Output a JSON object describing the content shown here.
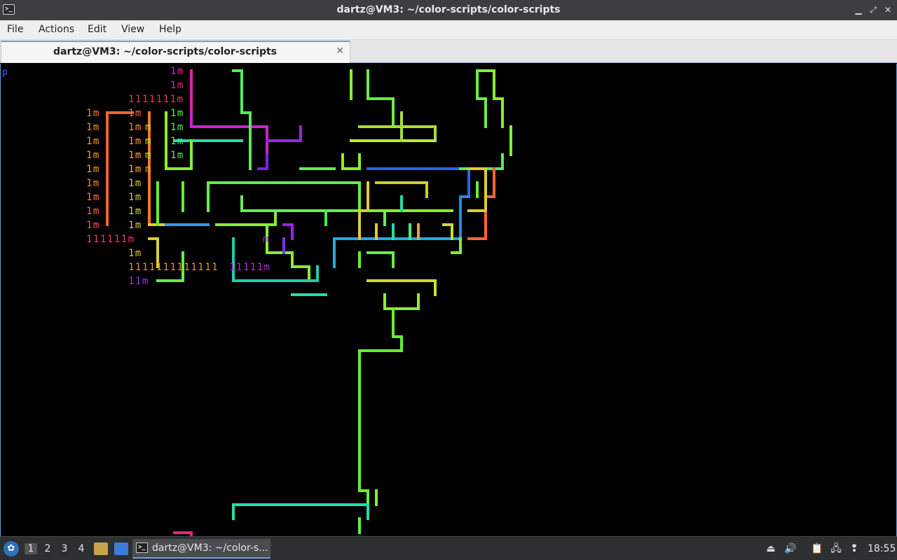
{
  "window": {
    "title": "dartz@VM3: ~/color-scripts/color-scripts",
    "app_icon": "terminal-icon",
    "controls": {
      "minimize": "▁",
      "maximize": "⤢",
      "close": "✕"
    }
  },
  "menubar": {
    "items": [
      {
        "label": "File"
      },
      {
        "label": "Actions"
      },
      {
        "label": "Edit"
      },
      {
        "label": "View"
      },
      {
        "label": "Help"
      }
    ]
  },
  "tabs": [
    {
      "label": "dartz@VM3: ~/color-scripts/color-scripts",
      "active": true
    }
  ],
  "terminal": {
    "prompt_fragment": "p",
    "text_rows": [
      {
        "text": "1m",
        "color": "#ee22aa",
        "row": 0,
        "col": 20
      },
      {
        "text": "1m",
        "color": "#ee2288",
        "row": 1,
        "col": 20
      },
      {
        "text": "1111111m",
        "color": "#ee3355",
        "row": 2,
        "col": 15
      },
      {
        "text": "1m",
        "color": "#ff7733",
        "row": 3,
        "col": 10
      },
      {
        "text": "1m",
        "color": "#ff6644",
        "row": 3,
        "col": 15
      },
      {
        "text": "1m",
        "color": "#66ee44",
        "row": 3,
        "col": 20
      },
      {
        "text": "1m",
        "color": "#ff8833",
        "row": 4,
        "col": 10
      },
      {
        "text": "1m",
        "color": "#ff8833",
        "row": 4,
        "col": 15
      },
      {
        "text": "m",
        "color": "#ddcc33",
        "row": 4,
        "col": 17
      },
      {
        "text": "1m",
        "color": "#55ee55",
        "row": 4,
        "col": 20
      },
      {
        "text": "1m",
        "color": "#ff9933",
        "row": 5,
        "col": 10
      },
      {
        "text": "1m",
        "color": "#ff9933",
        "row": 5,
        "col": 15
      },
      {
        "text": "m",
        "color": "#ccdd33",
        "row": 5,
        "col": 17
      },
      {
        "text": "1m",
        "color": "#44ee88",
        "row": 5,
        "col": 20
      },
      {
        "text": "1m",
        "color": "#ff9933",
        "row": 6,
        "col": 10
      },
      {
        "text": "1m",
        "color": "#ffaa33",
        "row": 6,
        "col": 15
      },
      {
        "text": "m",
        "color": "#bbee33",
        "row": 6,
        "col": 17
      },
      {
        "text": "1m",
        "color": "#55ee66",
        "row": 6,
        "col": 20
      },
      {
        "text": "1m",
        "color": "#ff9933",
        "row": 7,
        "col": 10
      },
      {
        "text": "1m",
        "color": "#ffaa33",
        "row": 7,
        "col": 15
      },
      {
        "text": "m",
        "color": "#ddaa33",
        "row": 7,
        "col": 17
      },
      {
        "text": "1m",
        "color": "#ff8833",
        "row": 8,
        "col": 10
      },
      {
        "text": "1m",
        "color": "#ddcc33",
        "row": 8,
        "col": 15
      },
      {
        "text": "1m",
        "color": "#ff7744",
        "row": 9,
        "col": 10
      },
      {
        "text": "1m",
        "color": "#ddcc33",
        "row": 9,
        "col": 15
      },
      {
        "text": "1m",
        "color": "#ff6644",
        "row": 10,
        "col": 10
      },
      {
        "text": "1m",
        "color": "#dddd33",
        "row": 10,
        "col": 15
      },
      {
        "text": "1m",
        "color": "#ff5555",
        "row": 11,
        "col": 10
      },
      {
        "text": "1m",
        "color": "#ddcc33",
        "row": 11,
        "col": 15
      },
      {
        "text": "111111m",
        "color": "#ff3366",
        "row": 12,
        "col": 10
      },
      {
        "text": "m",
        "color": "#aa22ee",
        "row": 12,
        "col": 31
      },
      {
        "text": "1m",
        "color": "#ddcc33",
        "row": 13,
        "col": 15
      },
      {
        "text": "1111111111111",
        "color": "#dd9933",
        "row": 14,
        "col": 15
      },
      {
        "text": "11111m",
        "color": "#bb22ee",
        "row": 14,
        "col": 27
      },
      {
        "text": "11m",
        "color": "#9933ff",
        "row": 15,
        "col": 15
      }
    ],
    "pipes": [
      {
        "color": "#dd22aa",
        "points": [
          [
            22,
            0
          ],
          [
            22,
            3
          ]
        ]
      },
      {
        "color": "#cc22cc",
        "points": [
          [
            22,
            3
          ],
          [
            22,
            4
          ],
          [
            28,
            4
          ],
          [
            31,
            4
          ],
          [
            31,
            6
          ]
        ]
      },
      {
        "color": "#9922ee",
        "points": [
          [
            35,
            4
          ],
          [
            35,
            5
          ],
          [
            31,
            5
          ]
        ]
      },
      {
        "color": "#7722ee",
        "points": [
          [
            31,
            6
          ],
          [
            31,
            7
          ],
          [
            30,
            7
          ]
        ]
      },
      {
        "color": "#22ddaa",
        "points": [
          [
            20,
            5
          ],
          [
            28,
            5
          ]
        ]
      },
      {
        "color": "#ee6633",
        "points": [
          [
            12,
            11
          ],
          [
            12,
            3
          ],
          [
            15,
            3
          ]
        ]
      },
      {
        "color": "#ff7722",
        "points": [
          [
            17,
            3
          ],
          [
            17,
            11
          ]
        ]
      },
      {
        "color": "#ddcc33",
        "points": [
          [
            17,
            11
          ],
          [
            19,
            11
          ]
        ]
      },
      {
        "color": "#3399ee",
        "points": [
          [
            19,
            11
          ],
          [
            24,
            11
          ]
        ]
      },
      {
        "color": "#88ee33",
        "points": [
          [
            19,
            3
          ],
          [
            19,
            7
          ],
          [
            22,
            7
          ],
          [
            22,
            5
          ]
        ]
      },
      {
        "color": "#66ee33",
        "points": [
          [
            18,
            8
          ],
          [
            18,
            11
          ]
        ]
      },
      {
        "color": "#66ee33",
        "points": [
          [
            21,
            8
          ],
          [
            21,
            10
          ]
        ]
      },
      {
        "color": "#55ee55",
        "points": [
          [
            27,
            0
          ],
          [
            28,
            0
          ],
          [
            28,
            3
          ],
          [
            29,
            3
          ],
          [
            29,
            7
          ]
        ]
      },
      {
        "color": "#66ee44",
        "points": [
          [
            24,
            10
          ],
          [
            24,
            8
          ],
          [
            42,
            8
          ],
          [
            42,
            10
          ]
        ]
      },
      {
        "color": "#88ee33",
        "points": [
          [
            25,
            11
          ],
          [
            32,
            11
          ],
          [
            32,
            10
          ],
          [
            35,
            10
          ]
        ]
      },
      {
        "color": "#66ee55",
        "points": [
          [
            28,
            9
          ],
          [
            28,
            10
          ],
          [
            29,
            10
          ],
          [
            45,
            10
          ],
          [
            45,
            11
          ]
        ]
      },
      {
        "color": "#88ee33",
        "points": [
          [
            31,
            11
          ],
          [
            31,
            13
          ],
          [
            34,
            13
          ],
          [
            34,
            14
          ],
          [
            36,
            14
          ],
          [
            36,
            15
          ]
        ]
      },
      {
        "color": "#22ccaa",
        "points": [
          [
            27,
            12
          ],
          [
            27,
            15
          ],
          [
            37,
            15
          ],
          [
            37,
            14
          ]
        ]
      },
      {
        "color": "#22ddaa",
        "points": [
          [
            34,
            16
          ],
          [
            38,
            16
          ]
        ]
      },
      {
        "color": "#66ee44",
        "points": [
          [
            21,
            13
          ],
          [
            21,
            15
          ],
          [
            18,
            15
          ]
        ]
      },
      {
        "color": "#ddcc33",
        "points": [
          [
            17,
            12
          ],
          [
            18,
            12
          ],
          [
            18,
            14
          ]
        ]
      },
      {
        "color": "#9922ee",
        "points": [
          [
            33,
            11
          ],
          [
            34,
            11
          ],
          [
            34,
            12
          ]
        ]
      },
      {
        "color": "#7733ee",
        "points": [
          [
            33,
            12
          ],
          [
            33,
            13
          ]
        ]
      },
      {
        "color": "#88ee33",
        "points": [
          [
            41,
            0
          ],
          [
            41,
            2
          ]
        ]
      },
      {
        "color": "#66ee44",
        "points": [
          [
            43,
            0
          ],
          [
            43,
            2
          ],
          [
            46,
            2
          ],
          [
            46,
            4
          ]
        ]
      },
      {
        "color": "#aadd33",
        "points": [
          [
            42,
            4
          ],
          [
            51,
            4
          ],
          [
            51,
            5
          ]
        ]
      },
      {
        "color": "#bbee33",
        "points": [
          [
            41,
            5
          ],
          [
            51,
            5
          ]
        ]
      },
      {
        "color": "#88ee33",
        "points": [
          [
            40,
            6
          ],
          [
            40,
            7
          ],
          [
            42,
            7
          ],
          [
            42,
            6
          ]
        ]
      },
      {
        "color": "#66ee44",
        "points": [
          [
            35,
            7
          ],
          [
            39,
            7
          ]
        ]
      },
      {
        "color": "#aadd33",
        "points": [
          [
            47,
            3
          ],
          [
            47,
            5
          ]
        ]
      },
      {
        "color": "#2266ee",
        "points": [
          [
            43,
            7
          ],
          [
            55,
            7
          ],
          [
            55,
            9
          ]
        ]
      },
      {
        "color": "#2288ee",
        "points": [
          [
            55,
            9
          ],
          [
            54,
            9
          ],
          [
            54,
            12
          ],
          [
            53,
            12
          ]
        ]
      },
      {
        "color": "#22aadd",
        "points": [
          [
            54,
            12
          ],
          [
            39,
            12
          ],
          [
            39,
            14
          ]
        ]
      },
      {
        "color": "#ddcc33",
        "points": [
          [
            43,
            8
          ],
          [
            43,
            10
          ],
          [
            42,
            10
          ],
          [
            42,
            12
          ]
        ]
      },
      {
        "color": "#cccc33",
        "points": [
          [
            44,
            8
          ],
          [
            50,
            8
          ],
          [
            50,
            9
          ]
        ]
      },
      {
        "color": "#88ee33",
        "points": [
          [
            43,
            10
          ],
          [
            53,
            10
          ]
        ]
      },
      {
        "color": "#22ddaa",
        "points": [
          [
            47,
            9
          ],
          [
            47,
            10
          ]
        ]
      },
      {
        "color": "#22ddaa",
        "points": [
          [
            46,
            11
          ],
          [
            46,
            12
          ]
        ]
      },
      {
        "color": "#44ee88",
        "points": [
          [
            48,
            11
          ],
          [
            48,
            12
          ]
        ]
      },
      {
        "color": "#ddcc33",
        "points": [
          [
            44,
            11
          ],
          [
            44,
            12
          ]
        ]
      },
      {
        "color": "#ddaa33",
        "points": [
          [
            49,
            11
          ],
          [
            49,
            12
          ]
        ]
      },
      {
        "color": "#ccdd33",
        "points": [
          [
            52,
            11
          ],
          [
            53,
            11
          ],
          [
            53,
            12
          ]
        ]
      },
      {
        "color": "#44ee55",
        "points": [
          [
            38,
            10
          ],
          [
            38,
            11
          ]
        ]
      },
      {
        "color": "#66ee33",
        "points": [
          [
            42,
            13
          ],
          [
            42,
            14
          ]
        ]
      },
      {
        "color": "#66ee44",
        "points": [
          [
            43,
            13
          ],
          [
            46,
            13
          ],
          [
            46,
            14
          ]
        ]
      },
      {
        "color": "#ccdd33",
        "points": [
          [
            43,
            15
          ],
          [
            51,
            15
          ],
          [
            51,
            16
          ]
        ]
      },
      {
        "color": "#88ee33",
        "points": [
          [
            45,
            16
          ],
          [
            45,
            17
          ],
          [
            49,
            17
          ],
          [
            49,
            16
          ]
        ]
      },
      {
        "color": "#66ee33",
        "points": [
          [
            46,
            17
          ],
          [
            46,
            19
          ],
          [
            47,
            19
          ],
          [
            47,
            20
          ],
          [
            42,
            20
          ],
          [
            42,
            30
          ],
          [
            43,
            30
          ],
          [
            43,
            31
          ]
        ]
      },
      {
        "color": "#88ee33",
        "points": [
          [
            44,
            30
          ],
          [
            44,
            31
          ]
        ]
      },
      {
        "color": "#22ddaa",
        "points": [
          [
            27,
            32
          ],
          [
            27,
            31
          ],
          [
            43,
            31
          ],
          [
            43,
            32
          ]
        ]
      },
      {
        "color": "#66ee44",
        "points": [
          [
            42,
            32
          ],
          [
            42,
            33
          ]
        ]
      },
      {
        "color": "#88ee33",
        "points": [
          [
            56,
            0
          ],
          [
            58,
            0
          ],
          [
            58,
            2
          ],
          [
            59,
            2
          ],
          [
            59,
            4
          ]
        ]
      },
      {
        "color": "#66ee44",
        "points": [
          [
            56,
            0
          ],
          [
            56,
            2
          ],
          [
            57,
            2
          ],
          [
            57,
            4
          ]
        ]
      },
      {
        "color": "#88ee33",
        "points": [
          [
            60,
            4
          ],
          [
            60,
            6
          ]
        ]
      },
      {
        "color": "#55ee55",
        "points": [
          [
            54,
            7
          ],
          [
            59,
            7
          ],
          [
            59,
            6
          ]
        ]
      },
      {
        "color": "#ff6633",
        "points": [
          [
            58,
            7
          ],
          [
            58,
            9
          ],
          [
            57,
            9
          ],
          [
            57,
            12
          ],
          [
            55,
            12
          ]
        ]
      },
      {
        "color": "#ddcc33",
        "points": [
          [
            55,
            7
          ],
          [
            57,
            7
          ],
          [
            57,
            10
          ],
          [
            55,
            10
          ]
        ]
      },
      {
        "color": "#66ee33",
        "points": [
          [
            56,
            8
          ],
          [
            56,
            9
          ]
        ]
      },
      {
        "color": "#88ee33",
        "points": [
          [
            53,
            13
          ],
          [
            54,
            13
          ],
          [
            54,
            12
          ]
        ]
      },
      {
        "color": "#ee2277",
        "points": [
          [
            20,
            33
          ],
          [
            22,
            33
          ],
          [
            22,
            34
          ]
        ]
      }
    ]
  },
  "taskbar": {
    "start_icon": "lxqt-start-icon",
    "start_glyph": "✿",
    "workspaces": [
      {
        "label": "1",
        "active": true
      },
      {
        "label": "2"
      },
      {
        "label": "3"
      },
      {
        "label": "4"
      }
    ],
    "quicklaunch": [
      {
        "icon": "file-manager-icon",
        "color": "#c9a24a"
      },
      {
        "icon": "show-desktop-icon",
        "color": "#3b7dd8"
      }
    ],
    "task": {
      "label": "dartz@VM3: ~/color-s...",
      "icon": "terminal-icon"
    },
    "tray": [
      {
        "icon": "eject-icon",
        "glyph": "⏏"
      },
      {
        "icon": "volume-icon",
        "glyph": "🔊"
      },
      {
        "icon": "clipboard-icon",
        "glyph": "📋"
      },
      {
        "icon": "network-icon",
        "glyph": "🖧"
      },
      {
        "icon": "update-notifier-icon",
        "glyph": "❢"
      }
    ],
    "clock": "18:55"
  }
}
